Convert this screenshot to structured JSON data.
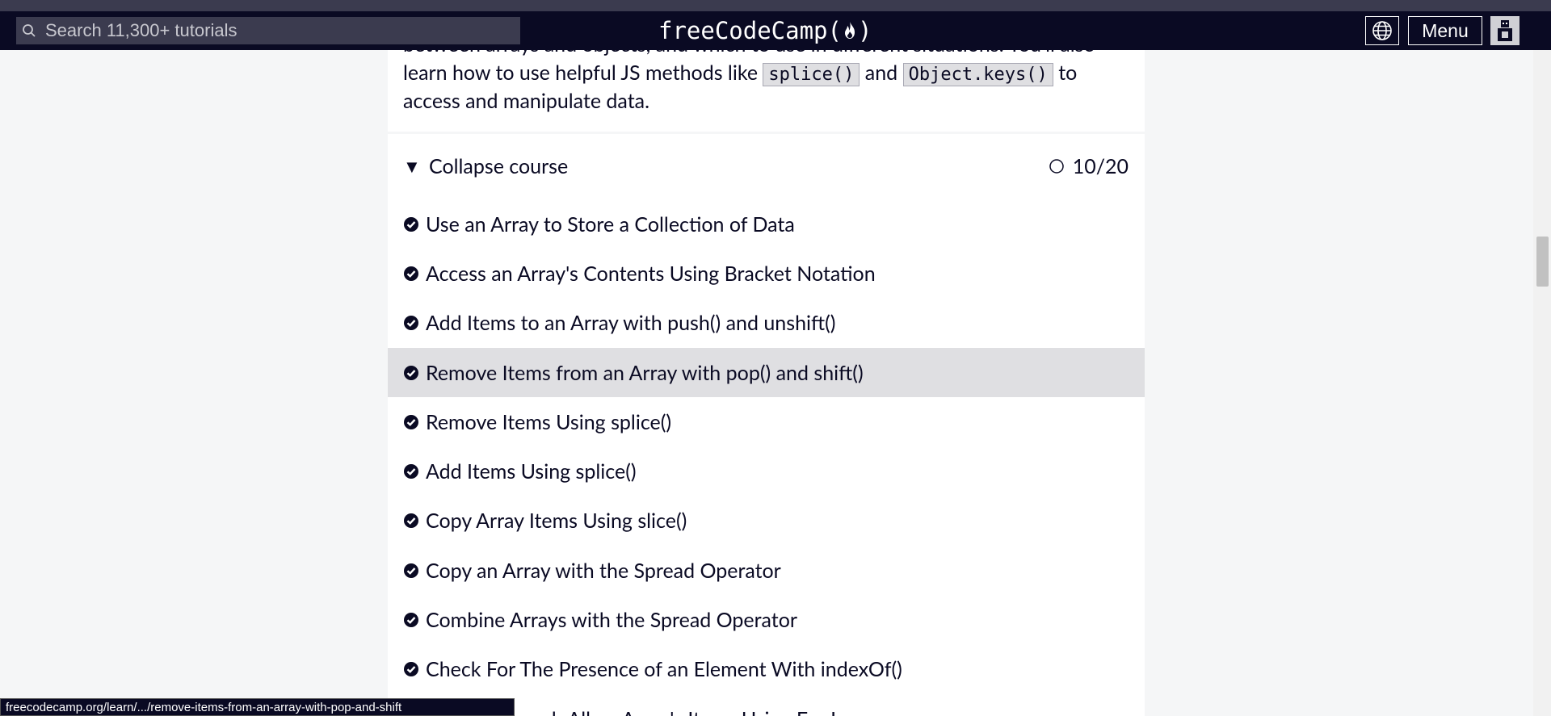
{
  "header": {
    "search_placeholder": "Search 11,300+ tutorials",
    "brand_left": "freeCodeCamp(",
    "brand_right": ")",
    "menu_label": "Menu"
  },
  "intro": {
    "line1": "between arrays and objects, and which to use in different situations. You'll also",
    "line2_pre": "learn how to use helpful JS methods like",
    "code1": "splice()",
    "line2_mid": "and",
    "code2": "Object.keys()",
    "line2_post": "to",
    "line3": "access and manipulate data."
  },
  "course": {
    "collapse_label": "Collapse course",
    "progress": "10/20",
    "lessons": [
      {
        "label": "Use an Array to Store a Collection of Data"
      },
      {
        "label": "Access an Array's Contents Using Bracket Notation"
      },
      {
        "label": "Add Items to an Array with push() and unshift()"
      },
      {
        "label": "Remove Items from an Array with pop() and shift()"
      },
      {
        "label": "Remove Items Using splice()"
      },
      {
        "label": "Add Items Using splice()"
      },
      {
        "label": "Copy Array Items Using slice()"
      },
      {
        "label": "Copy an Array with the Spread Operator"
      },
      {
        "label": "Combine Arrays with the Spread Operator"
      },
      {
        "label": "Check For The Presence of an Element With indexOf()"
      },
      {
        "label": "Iterate Through All an Array's Items Using For Loops"
      }
    ]
  },
  "status_url": "freecodecamp.org/learn/.../remove-items-from-an-array-with-pop-and-shift"
}
